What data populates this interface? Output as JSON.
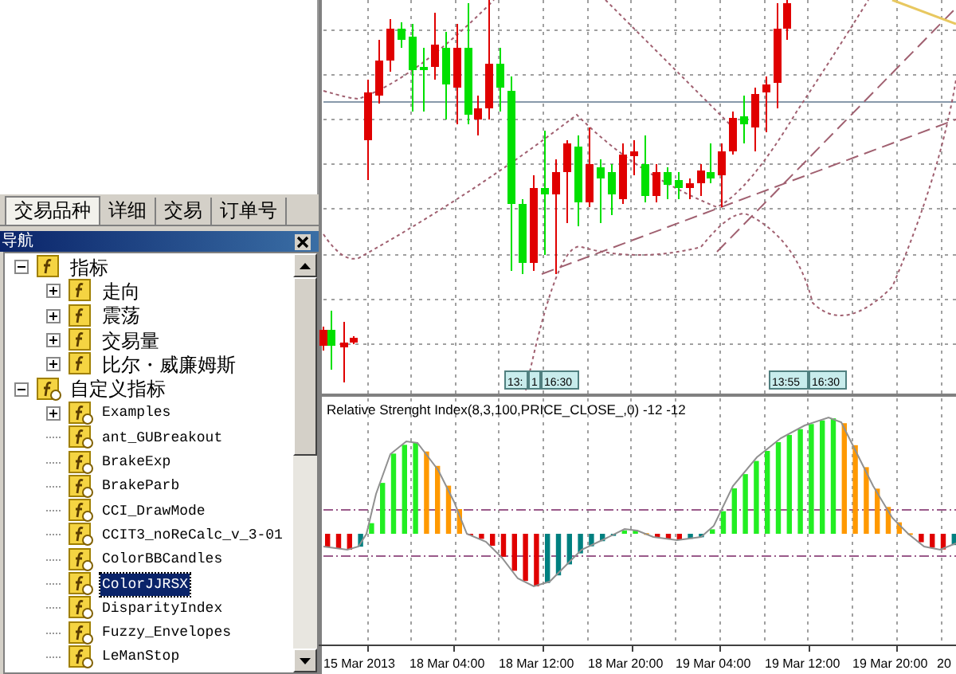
{
  "market_watch_tabs": [
    {
      "label": "交易品种",
      "selected": true
    },
    {
      "label": "详细",
      "selected": false
    },
    {
      "label": "交易",
      "selected": false
    },
    {
      "label": "订单号",
      "selected": false
    }
  ],
  "navigator": {
    "title": "导航",
    "tree": [
      {
        "label": "指标",
        "kind": "builtin",
        "expanded": true,
        "selected": false,
        "children": [
          {
            "label": "走向",
            "kind": "builtin",
            "expanded": false,
            "selected": false
          },
          {
            "label": "震荡",
            "kind": "builtin",
            "expanded": false,
            "selected": false
          },
          {
            "label": "交易量",
            "kind": "builtin",
            "expanded": false,
            "selected": false
          },
          {
            "label": "比尔・威廉姆斯",
            "kind": "builtin",
            "expanded": false,
            "selected": false
          }
        ]
      },
      {
        "label": "自定义指标",
        "kind": "custom",
        "expanded": true,
        "selected": false,
        "children": [
          {
            "label": "Examples",
            "kind": "custom",
            "expanded": false,
            "selected": false
          },
          {
            "label": "ant_GUBreakout",
            "kind": "custom",
            "selected": false
          },
          {
            "label": "BrakeExp",
            "kind": "custom",
            "selected": false
          },
          {
            "label": "BrakeParb",
            "kind": "custom",
            "selected": false
          },
          {
            "label": "CCI_DrawMode",
            "kind": "custom",
            "selected": false
          },
          {
            "label": "CCIT3_noReCalc_v_3-01",
            "kind": "custom",
            "selected": false
          },
          {
            "label": "ColorBBCandles",
            "kind": "custom",
            "selected": false
          },
          {
            "label": "ColorJJRSX",
            "kind": "custom",
            "selected": true
          },
          {
            "label": "DisparityIndex",
            "kind": "custom",
            "selected": false
          },
          {
            "label": "Fuzzy_Envelopes",
            "kind": "custom",
            "selected": false
          },
          {
            "label": "LeManStop",
            "kind": "custom",
            "selected": false
          }
        ]
      }
    ]
  },
  "chart": {
    "time_tags": [
      "13:",
      "1",
      "16:30",
      "13:55",
      "16:30"
    ],
    "indicator_label": "Relative Strenght Index(8,3,100,PRICE_CLOSE_,0) -12 -12",
    "time_axis": [
      "15 Mar 2013",
      "18 Mar 04:00",
      "18 Mar 12:00",
      "18 Mar 20:00",
      "19 Mar 04:00",
      "19 Mar 12:00",
      "19 Mar 20:00",
      "20"
    ]
  }
}
